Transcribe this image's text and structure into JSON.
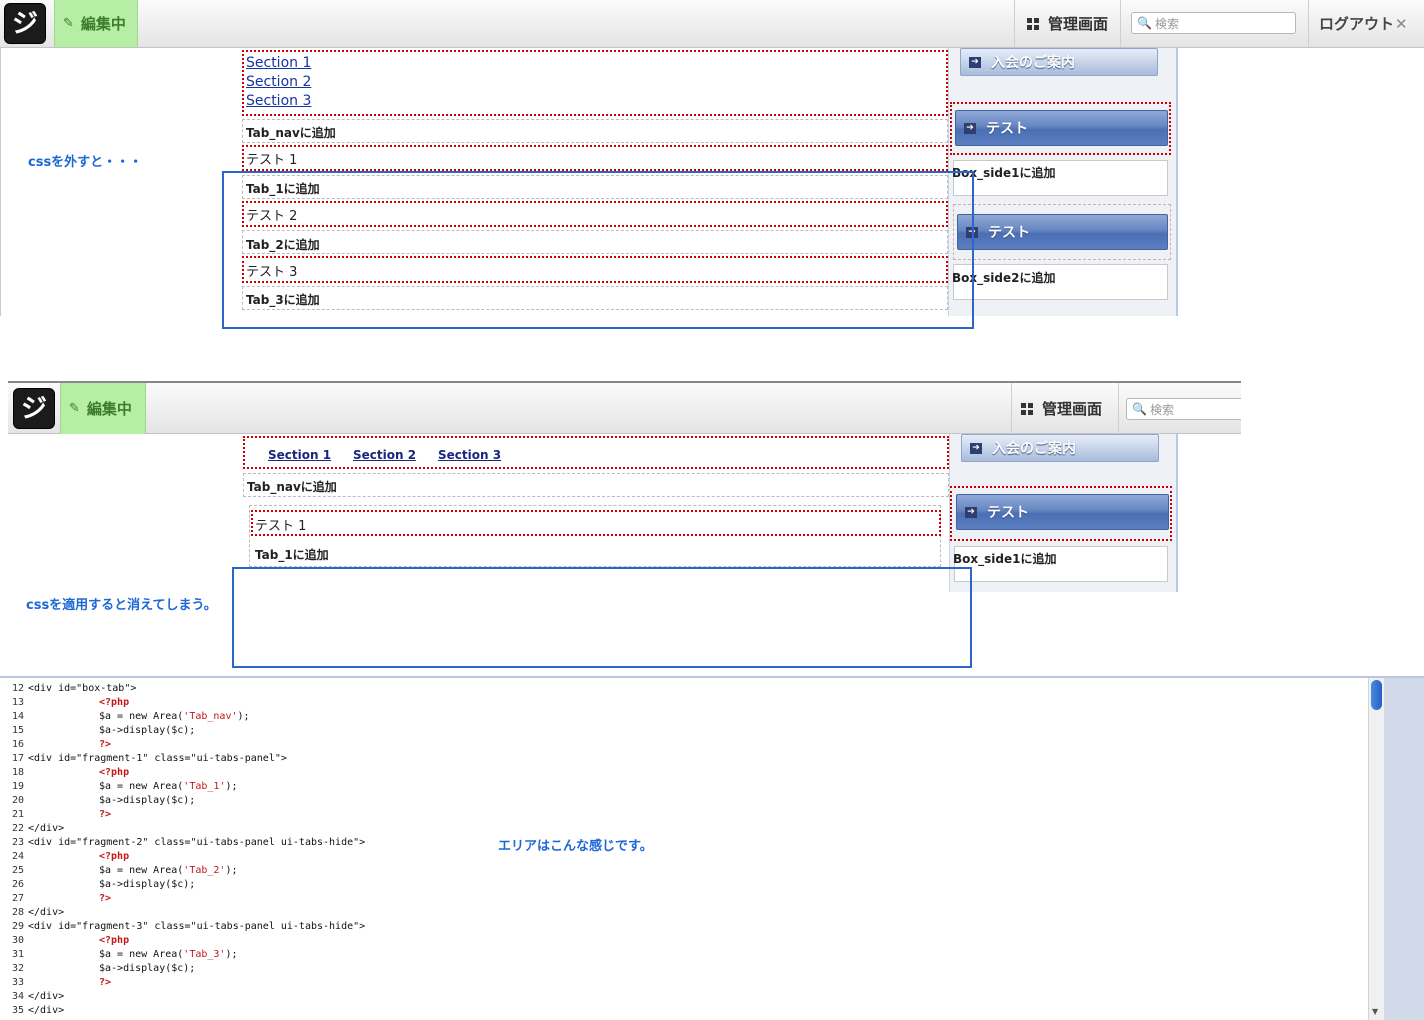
{
  "toolbar": {
    "logo_text": "ジ",
    "editing_label": "編集中",
    "admin_label": "管理画面",
    "search_placeholder": "検索",
    "logout_label": "ログアウト"
  },
  "screen1": {
    "sections": [
      "Section 1",
      "Section 2",
      "Section 3"
    ],
    "tab_nav_add": "Tab_navに追加",
    "tests": [
      "テスト 1",
      "テスト 2",
      "テスト 3"
    ],
    "tab_adds": [
      "Tab_1に追加",
      "Tab_2に追加",
      "Tab_3に追加"
    ],
    "sidebar_join": "入会のご案内",
    "sidebar_test": "テスト",
    "box_side1_add": "Box_side1に追加",
    "box_side2_add": "Box_side2に追加",
    "note": "cssを外すと・・・"
  },
  "screen2": {
    "sections": [
      "Section 1",
      "Section 2",
      "Section 3"
    ],
    "tab_nav_add": "Tab_navに追加",
    "test1": "テスト 1",
    "tab1_add": "Tab_1に追加",
    "sidebar_join": "入会のご案内",
    "sidebar_test": "テスト",
    "box_side1_add": "Box_side1に追加",
    "note": "cssを適用すると消えてしまう。"
  },
  "code": {
    "note": "エリアはこんな感じです。",
    "line_numbers": [
      "12",
      "13",
      "14",
      "15",
      "16",
      "17",
      "18",
      "19",
      "20",
      "21",
      "22",
      "23",
      "24",
      "25",
      "26",
      "27",
      "28",
      "29",
      "30",
      "31",
      "32",
      "33",
      "34",
      "35"
    ],
    "lines": [
      {
        "indent": 0,
        "text": "<div id=\"box-tab\">"
      },
      {
        "indent": 1,
        "text": "<?php",
        "kw": true
      },
      {
        "indent": 1,
        "text": "$a = new Area('Tab_nav');"
      },
      {
        "indent": 1,
        "text": "$a->display($c);"
      },
      {
        "indent": 1,
        "text": "?>",
        "kw": true
      },
      {
        "indent": 0,
        "text": "<div id=\"fragment-1\" class=\"ui-tabs-panel\">"
      },
      {
        "indent": 1,
        "text": "<?php",
        "kw": true
      },
      {
        "indent": 1,
        "text": "$a = new Area('Tab_1');"
      },
      {
        "indent": 1,
        "text": "$a->display($c);"
      },
      {
        "indent": 1,
        "text": "?>",
        "kw": true
      },
      {
        "indent": 0,
        "text": "</div>"
      },
      {
        "indent": 0,
        "text": "<div id=\"fragment-2\" class=\"ui-tabs-panel ui-tabs-hide\">"
      },
      {
        "indent": 1,
        "text": "<?php",
        "kw": true
      },
      {
        "indent": 1,
        "text": "$a = new Area('Tab_2');"
      },
      {
        "indent": 1,
        "text": "$a->display($c);"
      },
      {
        "indent": 1,
        "text": "?>",
        "kw": true
      },
      {
        "indent": 0,
        "text": "</div>"
      },
      {
        "indent": 0,
        "text": "<div id=\"fragment-3\" class=\"ui-tabs-panel ui-tabs-hide\">"
      },
      {
        "indent": 1,
        "text": "<?php",
        "kw": true
      },
      {
        "indent": 1,
        "text": "$a = new Area('Tab_3');"
      },
      {
        "indent": 1,
        "text": "$a->display($c);"
      },
      {
        "indent": 1,
        "text": "?>",
        "kw": true
      },
      {
        "indent": 0,
        "text": "</div>"
      },
      {
        "indent": 0,
        "text": "</div>"
      }
    ]
  }
}
